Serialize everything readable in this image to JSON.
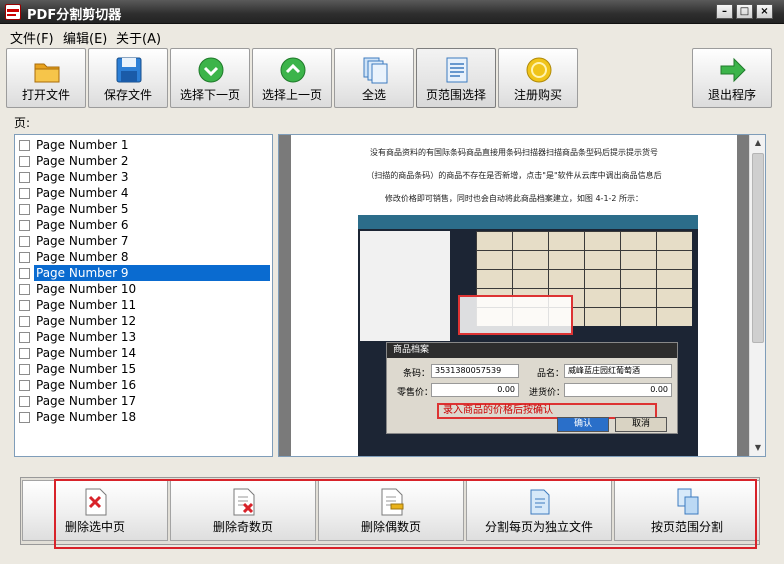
{
  "window": {
    "title": "PDF分割剪切器",
    "controls": [
      "minimize",
      "maximize",
      "close"
    ]
  },
  "menu": [
    "文件(F)",
    "编辑(E)",
    "关于(A)"
  ],
  "toolbar": [
    {
      "label": "打开文件",
      "icon": "open-folder-icon"
    },
    {
      "label": "保存文件",
      "icon": "save-disk-icon"
    },
    {
      "label": "选择下一页",
      "icon": "down-arrow-icon"
    },
    {
      "label": "选择上一页",
      "icon": "up-arrow-icon"
    },
    {
      "label": "全选",
      "icon": "select-all-icon"
    },
    {
      "label": "页范围选择",
      "icon": "page-range-icon"
    },
    {
      "label": "注册购买",
      "icon": "coin-icon"
    },
    {
      "label": "退出程序",
      "icon": "exit-arrow-icon"
    }
  ],
  "pages_label": "页:",
  "pages": [
    "Page Number 1",
    "Page Number 2",
    "Page Number 3",
    "Page Number 4",
    "Page Number 5",
    "Page Number 6",
    "Page Number 7",
    "Page Number 8",
    "Page Number 9",
    "Page Number 10",
    "Page Number 11",
    "Page Number 12",
    "Page Number 13",
    "Page Number 14",
    "Page Number 15",
    "Page Number 16",
    "Page Number 17",
    "Page Number 18"
  ],
  "selected_page_index": 8,
  "preview": {
    "lines": [
      "没有商品资料的有国际条码商品直接用条码扫描器扫描商品条型码后提示提示货号",
      "（扫描的商品条码）的商品不存在是否新增，点击\"是\"软件从云库中调出商品信息后",
      "修改价格即可销售，同时也会自动将此商品档案建立，如图 4-1-2 所示："
    ],
    "dialog": {
      "title": "商品档案",
      "barcode_label": "条码：",
      "barcode_value": "3531380057539",
      "name_label": "品名：",
      "name_value": "威峰蓝庄园红葡萄酒",
      "retail_label": "零售价：",
      "retail_value": "0.00",
      "cost_label": "进货价：",
      "cost_value": "0.00",
      "note": "录入商品的价格后按确认",
      "confirm": "确认",
      "cancel": "取消"
    }
  },
  "bottom_buttons": [
    {
      "label": "删除选中页",
      "icon": "delete-page-icon"
    },
    {
      "label": "删除奇数页",
      "icon": "delete-odd-icon"
    },
    {
      "label": "删除偶数页",
      "icon": "delete-even-icon"
    },
    {
      "label": "分割每页为独立文件",
      "icon": "split-each-icon"
    },
    {
      "label": "按页范围分割",
      "icon": "split-range-icon"
    }
  ],
  "colors": {
    "selection": "#0a6bd0",
    "highlight_outline": "#d8232a",
    "titlebar": "#2e2e2e"
  }
}
